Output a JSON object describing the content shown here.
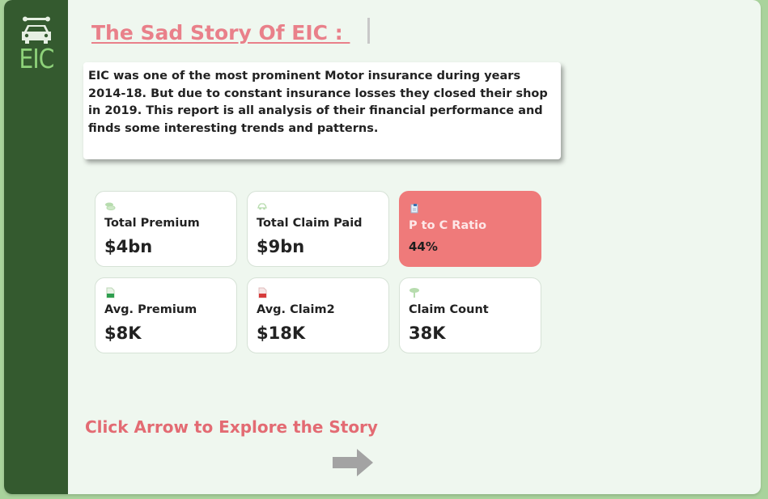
{
  "logo": {
    "text": "EIC",
    "icon": "car-wrench-icon"
  },
  "title": "The Sad Story Of EIC : ",
  "intro": "EIC was one of the most prominent Motor insurance during years 2014-18. But due to constant insurance losses they closed their shop in 2019. This report is all analysis of their financial performance and finds some interesting trends and patterns.",
  "cards": [
    {
      "label": "Total Premium",
      "value": "$4bn",
      "icon": "coins-icon"
    },
    {
      "label": "Total Claim Paid",
      "value": "$9bn",
      "icon": "car-icon"
    },
    {
      "label": "P to C Ratio",
      "value": "44%",
      "icon": "report-icon"
    },
    {
      "label": "Avg. Premium",
      "value": "$8K",
      "icon": "green-document-icon"
    },
    {
      "label": "Avg. Claim2",
      "value": "$18K",
      "icon": "red-document-icon"
    },
    {
      "label": "Claim Count",
      "value": "38K",
      "icon": "tree-icon"
    }
  ],
  "explore_text": "Click Arrow to Explore the Story",
  "colors": {
    "sidebar": "#345a2f",
    "accent_pink": "#e9808a",
    "highlight_card": "#ef7a7a",
    "background": "#eff7ef"
  }
}
